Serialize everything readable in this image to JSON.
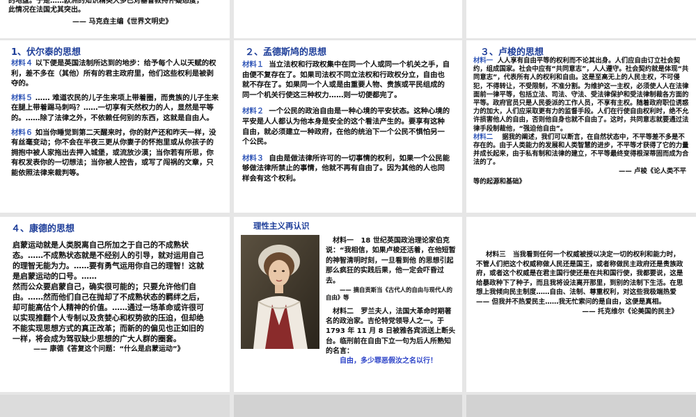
{
  "top_left": {
    "line1": "的地盘。于是……欧洲的知识精英大多已对基督教持怀疑态度，",
    "line2": "此情况在法国尤其突出。",
    "source": "—— 马克垚主编《世界文明史》"
  },
  "voltaire": {
    "title": "1、伏尔泰的思想",
    "m4_label": "材料４",
    "m4_text": "以下便是英国法制所达到的地步：给予每个人以天赋的权利，差不多在（其他）所有的君主政府里，他们这些权利是被剥夺的。",
    "m5_label": "材料５",
    "m5_text": "…… 难道农民的儿子生来项上带着圈，而贵族的儿子生来在腿上带着踢马刺吗？……一切享有天然权力的人，显然是平等的。……除了法律之外，不依赖任何别的东西，这就是自由人。",
    "m6_label": "材料６",
    "m6_text": "如当你睡觉到第二天醒来时，你的财产还和昨天一样，没有丝毫变动；你不会在半夜三更从你妻子的怀抱里或从你孩子的拥抱中被人家拖出去押入城堡，或流放沙漠；当你若有所思，你有权发表你的一切想法；当你被人控告，或写了闯祸的文章，只能依照法律来裁判等。"
  },
  "montesquieu": {
    "title": "２、孟德斯鸠的思想",
    "m1_label": "材料１",
    "m1_text": "当立法权和行政权集中在同一个人或同一个机关之手，自由便不复存在了。如果司法权不同立法权和行政权分立，自由也就不存在了。如果同一个人或是由重要人物、贵族或平民组成的同一个机关行使这三种权力……则一切便都完了。",
    "m2_label": "材料２",
    "m2_text": "一个公民的政治自由是一种心境的平安状态。这种心境的平安是人人都认为他本身是安全的这个看法产生的。要享有这种自由，就必须建立一种政府，在他的统治下一个公民不惧怕另一个公民。",
    "m3_label": "材料３",
    "m3_text": "自由是做法律所许可的一切事情的权利，如果一个公民能够做法律所禁止的事情，他就不再有自由了。因为其他的人也同样会有这个权利。"
  },
  "rousseau": {
    "title": "３、卢梭的思想",
    "m1_label": "材料一",
    "m1_text": "人人享有自由平等的权利而不论其出身。人们应自由订立社会契约，组成国家。社会中应有“共同意志”，人人遵守。社会契约就是体现“共同意志”，代表所有人的权利和自由。这是至高无上的人民主权，不可侵犯，不得转让，不受限制，不准分割。为维护这一主权，必须使人人在法律面前一律平等，包括立法、司法、守法、受法律保护和受法律制裁各方面的平等。政府官员只是人民委派的工作人员，不享有主权。随着政府职位诱惑力的加大，人们应采取更有力的监督手段。人们在行使自由权利时，绝不允许损害他人的自由，否则他自身也就不自由了。这时，共同意志就要通过法律手段制裁他，“强迫他自由”。",
    "m2_label": "材料二",
    "m2_text": "据我的阐述，我们可以断言，在自然状态中，不平等差不多是不存在的。由于人类能力的发展和人类智慧的进步，不平等才获得了它的力量并成长起来，由于私有制和法律的建立，不平等最终变得根深蒂固而成为合法的了。",
    "source_line1": "—— 卢梭《论人类不平",
    "source_line2": "等的起源和基础》"
  },
  "kant": {
    "title": "４、康德的思想",
    "p1": "启蒙运动就是人类脱离自己所加之于自己的不成熟状态。……不成熟状态就是不经别人的引导，就对运用自己的理智无能为力。……要有勇气运用你自己的理智！这就是启蒙运动的口号。……",
    "p2": "然而公众要启蒙自己，确实很可能的；只要允许他们自由。……然而他们自己在抛却了不成熟状态的羁绊之后，却可能高估个人精神的价值。……通过一场革命或许很可以实现推翻个人专制以及贪婪心和权势欲的压迫，但却绝不能实现思想方式的真正改革；而新的的偏见也正如旧的一样，将会成为驾驭缺少思想的广大人群的圈套。",
    "source": "—— 康德《答复这个问题：“什么是启蒙运动”》"
  },
  "rational": {
    "title": "理性主义再认识",
    "m1_label": "材料一",
    "m1_text": "18 世纪英国政治理论家伯克说：“我相信，如果卢梭还活着，在他短暂的神智清明时刻，一旦看到他 的思想引起那么疯狂的实践后果，他一定会吓昏过去。",
    "m1_source": "—— 摘自贡斯当《古代人的自由与现代人的自由》等",
    "m2_label": "材料二",
    "m2_text": "罗兰夫人，法国大革命时期著名的政治家。吉伦特党领导人之一。于 1793 年 11 月 8 日被雅各宾派送上断头台。临刑前在自由下立一句为后人所熟知的名言：",
    "m2_quote": "自由，多少罪恶假汝之名以行！",
    "portrait_caption": ""
  },
  "tocqueville": {
    "m3_label": "材料三",
    "m3_text": "当我看到任何一个权威被授以决定一切的权利和能力时，不管人们把这个权威称做人民还是国王，或者称做民主政府还是贵族政府，或者这个权威是在君主国行使还是在共和国行使，我都要说，这是给暴政种下了种子，而且我将设法离开那里，到别的法制下生活。在思想上我倾向民主制度……自由、法制、尊重权利，对这些我极端热爱 —— 但我并不热爱民主……我无忙索问的是自由，这便是真相。",
    "source": "—— 托克维尔《论美国的民主》"
  },
  "colors": {
    "title_blue": "#1f3f9a",
    "label_blue": "#3358b8",
    "quote_blue": "#2d44c8",
    "panel_bg": "#ffffff",
    "gap_bg": "#e6e6e6"
  }
}
